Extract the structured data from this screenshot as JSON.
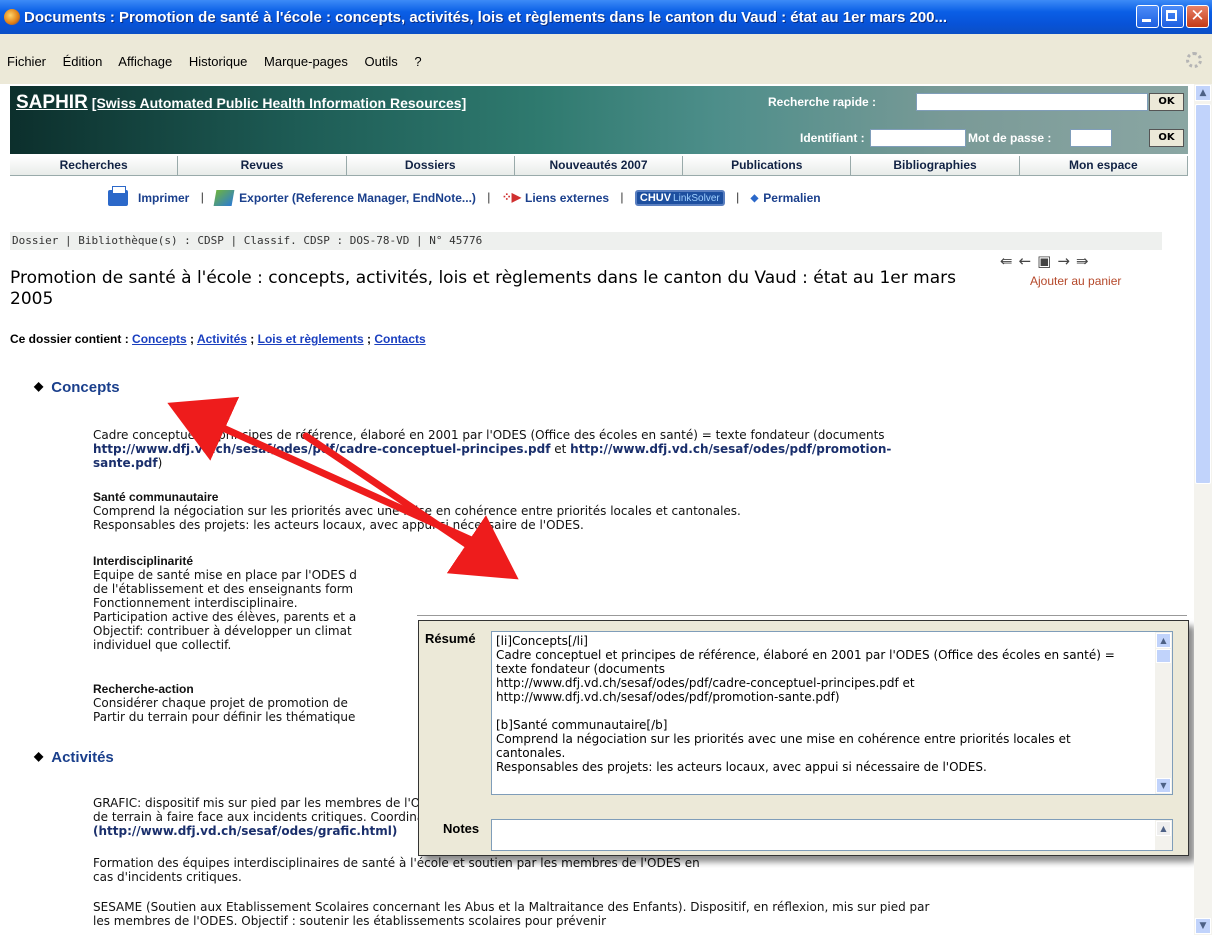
{
  "window": {
    "title": "Documents : Promotion de santé à l'école : concepts, activités, lois et règlements dans le canton du Vaud : état au 1er mars 200..."
  },
  "menu": [
    "Fichier",
    "Édition",
    "Affichage",
    "Historique",
    "Marque-pages",
    "Outils",
    "?"
  ],
  "banner": {
    "brand": "SAPHIR",
    "subtitle": "[Swiss Automated Public Health Information Resources]",
    "quick_search_label": "Recherche rapide :",
    "id_label": "Identifiant :",
    "password_label": "Mot de passe :",
    "ok": "OK"
  },
  "nav": [
    "Recherches",
    "Revues",
    "Dossiers",
    "Nouveautés 2007",
    "Publications",
    "Bibliographies",
    "Mon espace"
  ],
  "toolbar": {
    "print": "Imprimer",
    "export": "Exporter (Reference Manager, EndNote...)",
    "links": "Liens externes",
    "chuv": "CHUV",
    "linksolver": "LinkSolver",
    "permalink": "Permalien",
    "sep": "|"
  },
  "breadcrumb": "Dossier | Bibliothèque(s) : CDSP | Classif. CDSP : DOS-78-VD | N° 45776",
  "cart": "Ajouter au panier",
  "doc_title": "Promotion de santé à l'école : concepts, activités, lois et règlements dans le canton du Vaud : état au 1er mars 2005",
  "contains": {
    "label": "Ce dossier contient :",
    "links": [
      "Concepts",
      "Activités",
      "Lois et règlements",
      "Contacts"
    ],
    "sep": " ; "
  },
  "concepts": {
    "heading": "Concepts",
    "p1a": "Cadre conceptuel et principes de référence, élaboré en 2001 par l'ODES (Office des écoles en santé) = texte fondateur (documents ",
    "url1": "http://www.dfj.vd.ch/sesaf/odes/pdf/cadre-conceptuel-principes.pdf",
    "and": " et ",
    "url2": "http://www.dfj.vd.ch/sesaf/odes/pdf/promotion-sante.pdf",
    "close": ")",
    "h2": "Santé communautaire",
    "p2": "Comprend la négociation sur les priorités avec une mise en cohérence entre priorités locales et cantonales.",
    "p2b": "Responsables des projets: les acteurs locaux, avec appui si nécessaire de l'ODES.",
    "h3": "Interdisciplinarité",
    "p3": [
      "Equipe de santé mise en place par l'ODES d",
      "de l'établissement et des enseignants form",
      "Fonctionnement interdisciplinaire.",
      "Participation active des élèves, parents et a",
      "Objectif: contribuer à développer un climat",
      "individuel que collectif."
    ],
    "h4": "Recherche-action",
    "p4": [
      "Considérer chaque projet de promotion de",
      "Partir du terrain pour définir les thématique"
    ]
  },
  "activites": {
    "heading": "Activités",
    "p1": "GRAFIC: dispositif mis sur pied par les membres de l'ODES. Objectif: augmenter la capacité des acteurs de terrain à faire face aux incidents critiques. Coordinatrice: C. Gachet, psychologue.",
    "url1": "(http://www.dfj.vd.ch/sesaf/odes/grafic.html)",
    "p2": "Formation des équipes interdisciplinaires de santé à l'école et soutien par les membres de l'ODES en cas d'incidents critiques.",
    "p3": "SESAME (Soutien aux Etablissement Scolaires concernant les Abus et la Maltraitance des Enfants). Dispositif, en réflexion, mis sur pied par les membres de l'ODES. Objectif : soutenir les établissements scolaires pour prévenir"
  },
  "popup": {
    "resume_label": "Résumé",
    "notes_label": "Notes",
    "resume_text": "[li]Concepts[/li]\nCadre conceptuel et principes de référence, élaboré en 2001 par l'ODES (Office des écoles en santé) = texte fondateur (documents\nhttp://www.dfj.vd.ch/sesaf/odes/pdf/cadre-conceptuel-principes.pdf et\nhttp://www.dfj.vd.ch/sesaf/odes/pdf/promotion-sante.pdf)\n\n[b]Santé communautaire[/b]\nComprend la négociation sur les priorités avec une mise en cohérence entre priorités locales et cantonales.\nResponsables des projets: les acteurs locaux, avec appui si nécessaire de l'ODES.",
    "notes_text": ""
  }
}
